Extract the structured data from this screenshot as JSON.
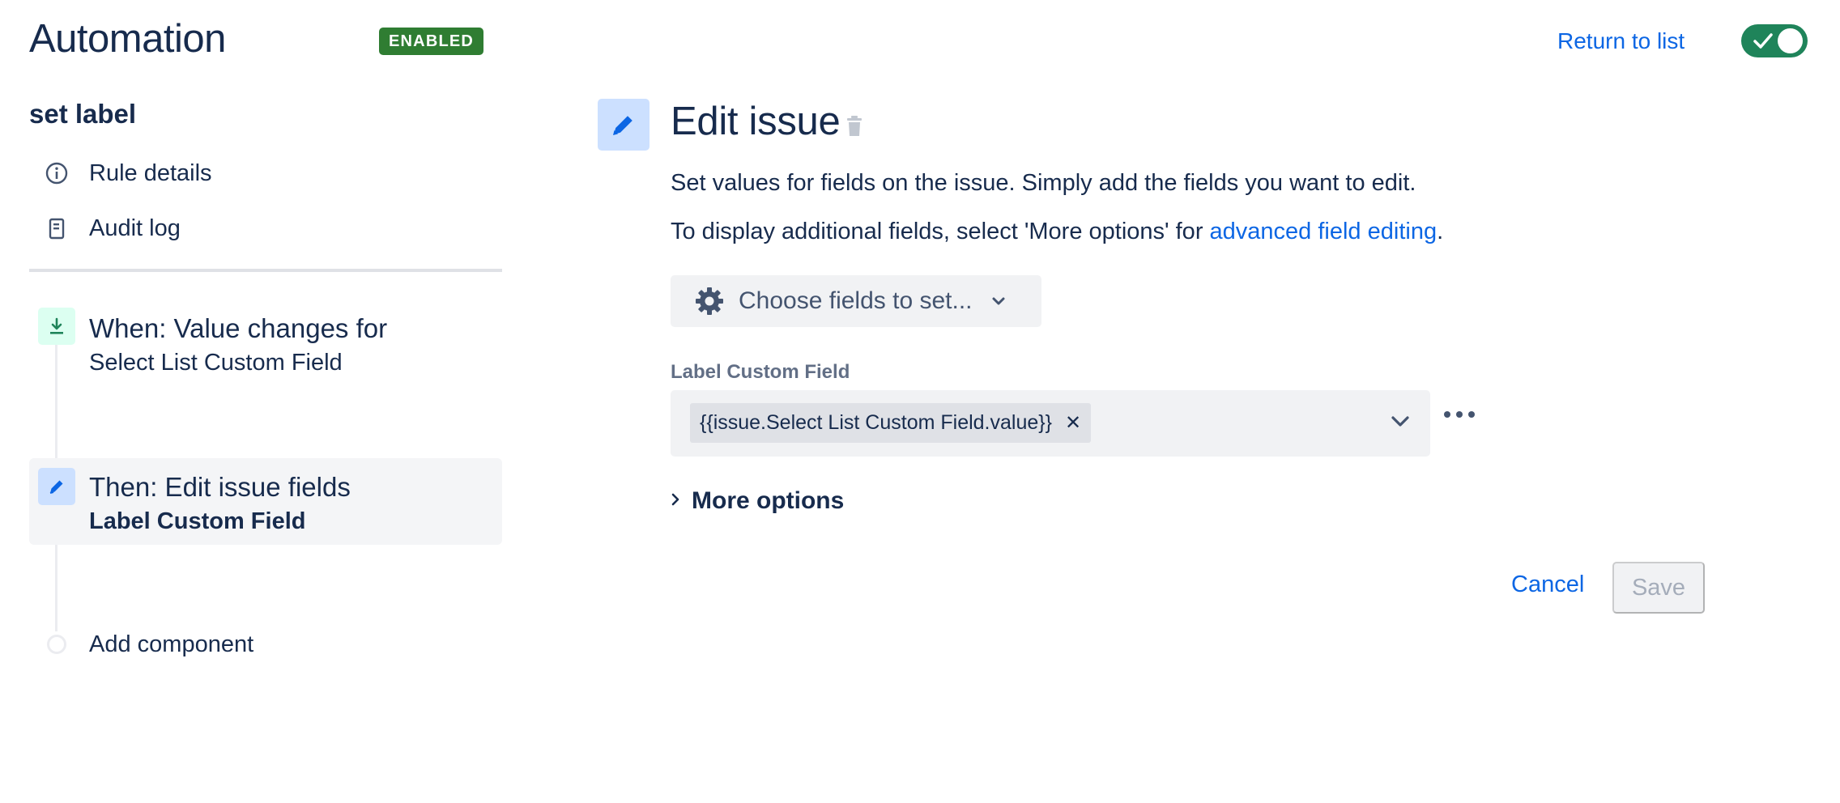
{
  "header": {
    "title": "Automation",
    "status_badge": "ENABLED",
    "return_link": "Return to list",
    "toggle_enabled": true
  },
  "sidebar": {
    "rule_name": "set label",
    "nav": [
      {
        "label": "Rule details",
        "icon": "info-icon"
      },
      {
        "label": "Audit log",
        "icon": "document-icon"
      }
    ],
    "components": [
      {
        "title": "When: Value changes for",
        "subtitle": "Select List Custom Field",
        "icon": "trigger-icon",
        "color": "#1F845A"
      },
      {
        "title": "Then: Edit issue fields",
        "subtitle": "Label Custom Field",
        "icon": "pencil-icon",
        "color": "#0C66E4",
        "selected": true
      }
    ],
    "add_component": "Add component"
  },
  "panel": {
    "title": "Edit issue",
    "description": "Set values for fields on the issue. Simply add the fields you want to edit.",
    "extra_prefix": "To display additional fields, select 'More options' for ",
    "extra_link": "advanced field editing",
    "extra_suffix": ".",
    "choose_fields": "Choose fields to set...",
    "field": {
      "label": "Label Custom Field",
      "value": "{{issue.Select List Custom Field.value}}"
    },
    "more_options": "More options",
    "cancel": "Cancel",
    "save": "Save"
  },
  "colors": {
    "accent": "#0C66E4",
    "enabled": "#2F7D32",
    "toggle": "#1F845A",
    "selected_bg": "#F4F5F7"
  }
}
